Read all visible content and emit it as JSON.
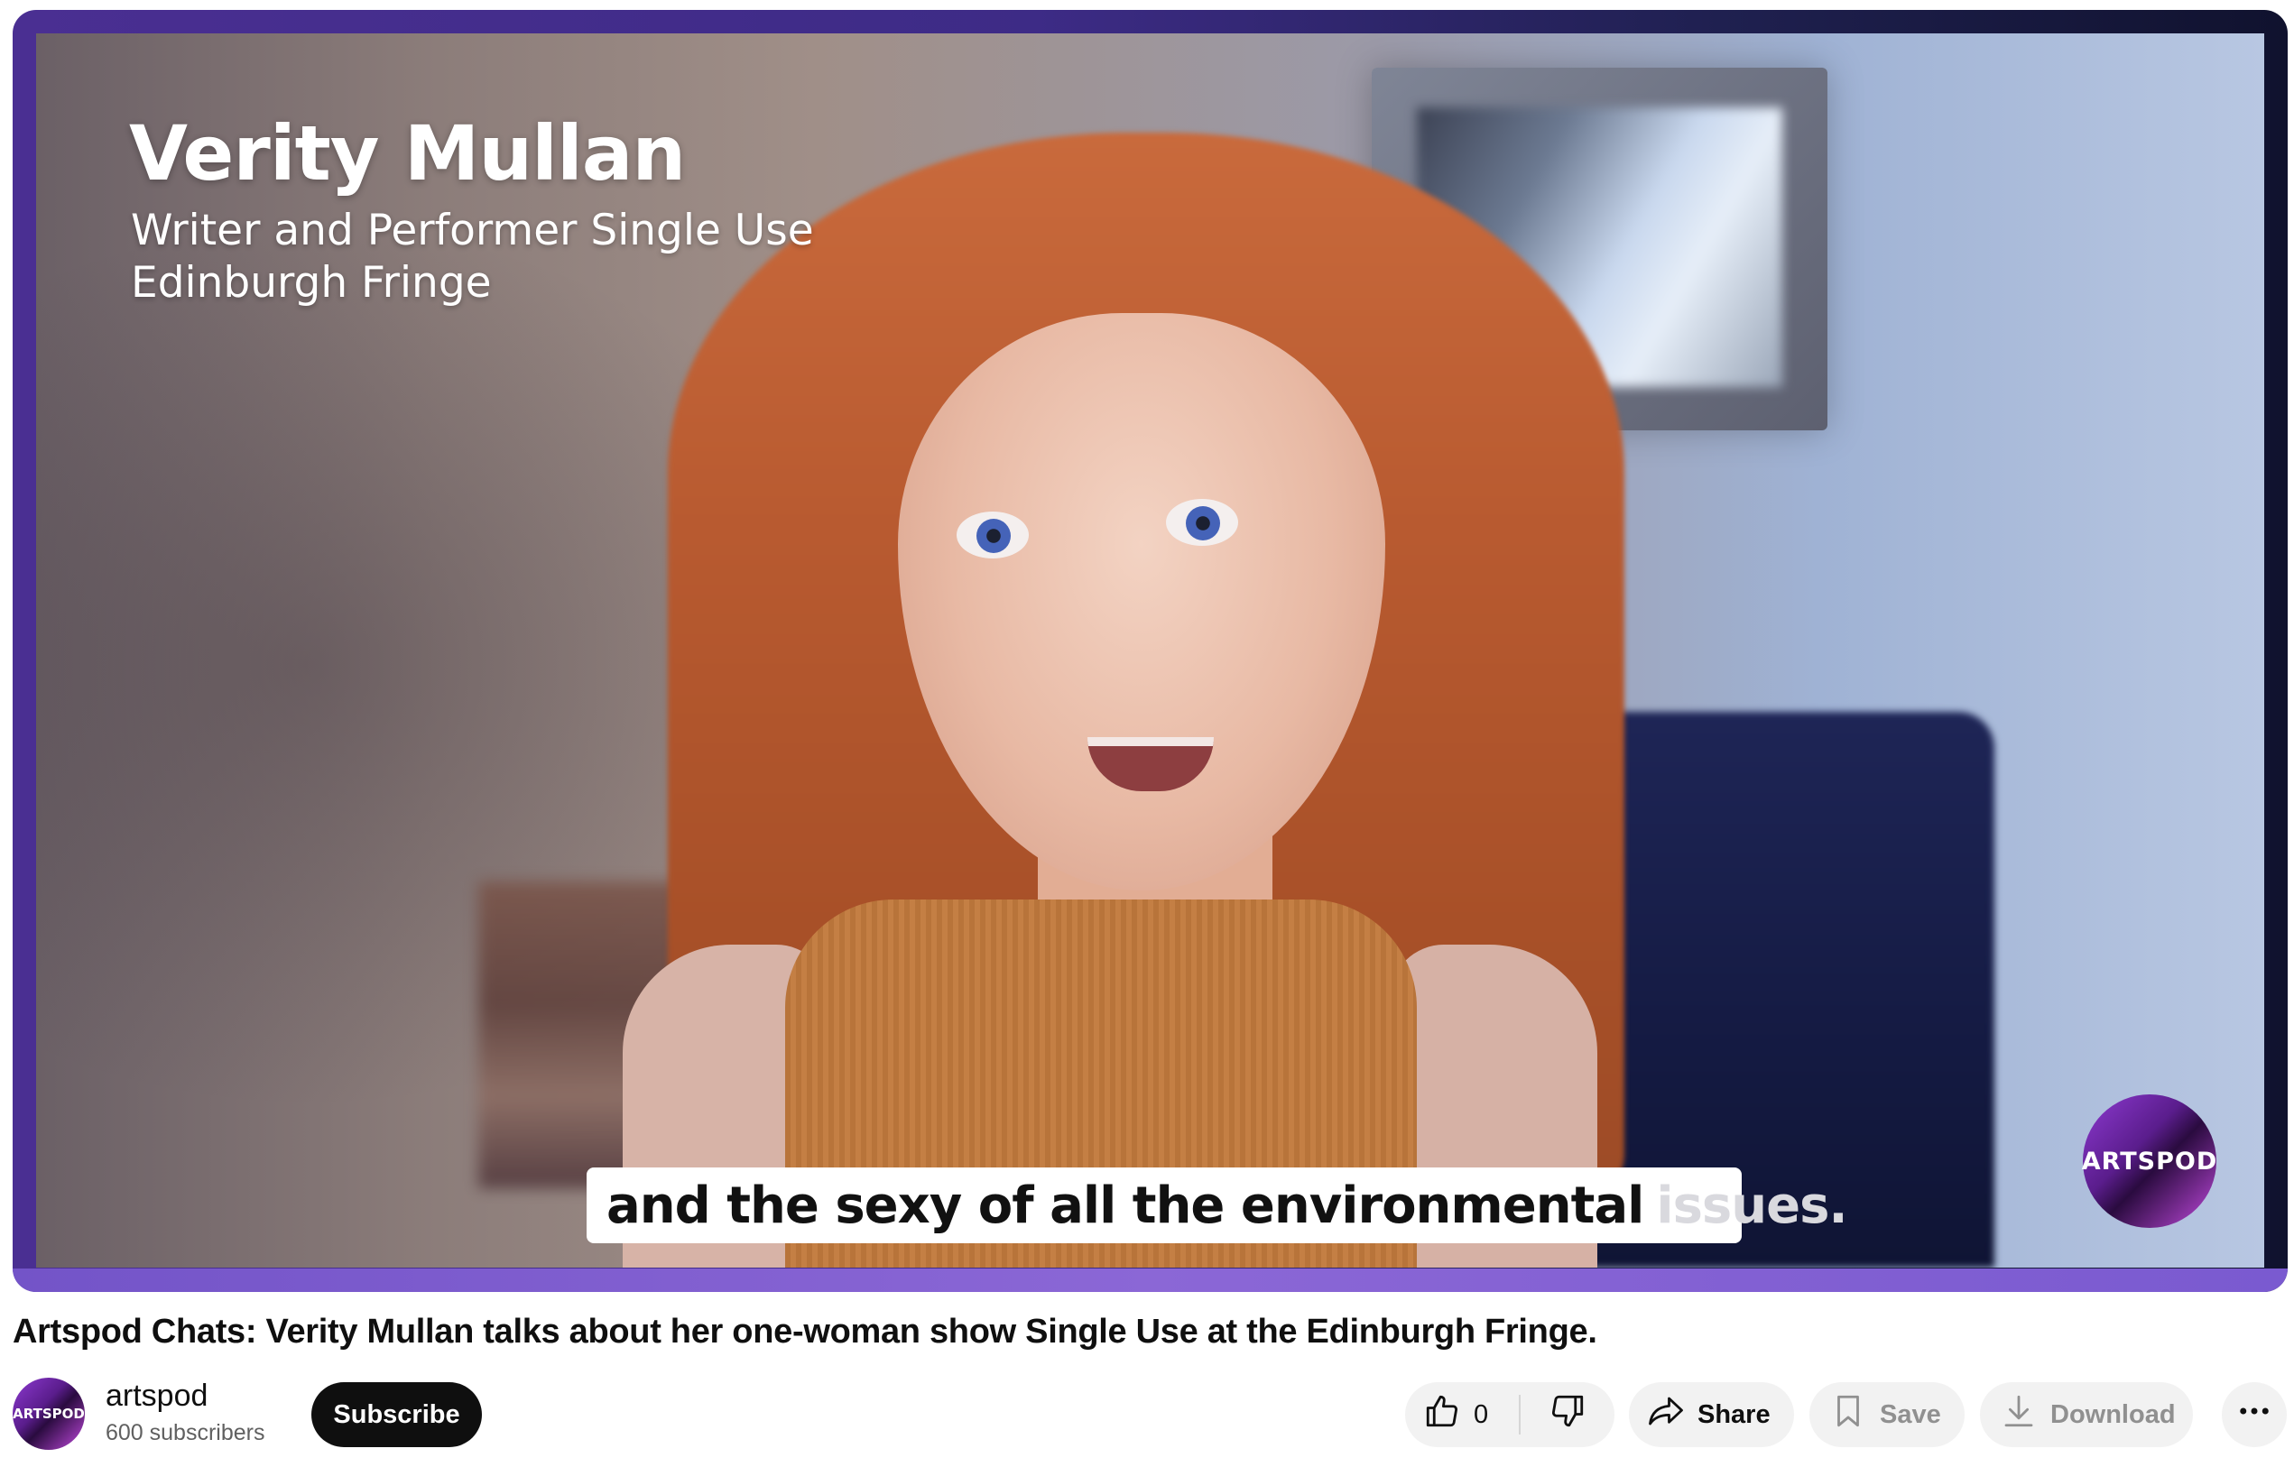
{
  "video": {
    "lower_third": {
      "name": "Verity Mullan",
      "role_line1": "Writer and Performer Single Use",
      "role_line2": "Edinburgh Fringe"
    },
    "caption": {
      "spoken": "and the sexy of all the environmental",
      "upcoming": "issues."
    },
    "watermark": "ARTSPOD"
  },
  "title": "Artspod Chats: Verity Mullan talks about her one-woman show Single Use at the Edinburgh Fringe.",
  "channel": {
    "avatar_text": "ARTSPOD",
    "name": "artspod",
    "subscribers": "600 subscribers",
    "subscribe_label": "Subscribe"
  },
  "actions": {
    "like_count": "0",
    "share_label": "Share",
    "save_label": "Save",
    "download_label": "Download"
  },
  "icons": [
    "thumbs-up-icon",
    "thumbs-down-icon",
    "share-icon",
    "bookmark-icon",
    "download-icon",
    "more-horizontal-icon"
  ],
  "colors": {
    "subscribe_bg": "#0f0f0f",
    "pill_bg": "#f2f2f2",
    "player_border": "#5b3fb0"
  }
}
